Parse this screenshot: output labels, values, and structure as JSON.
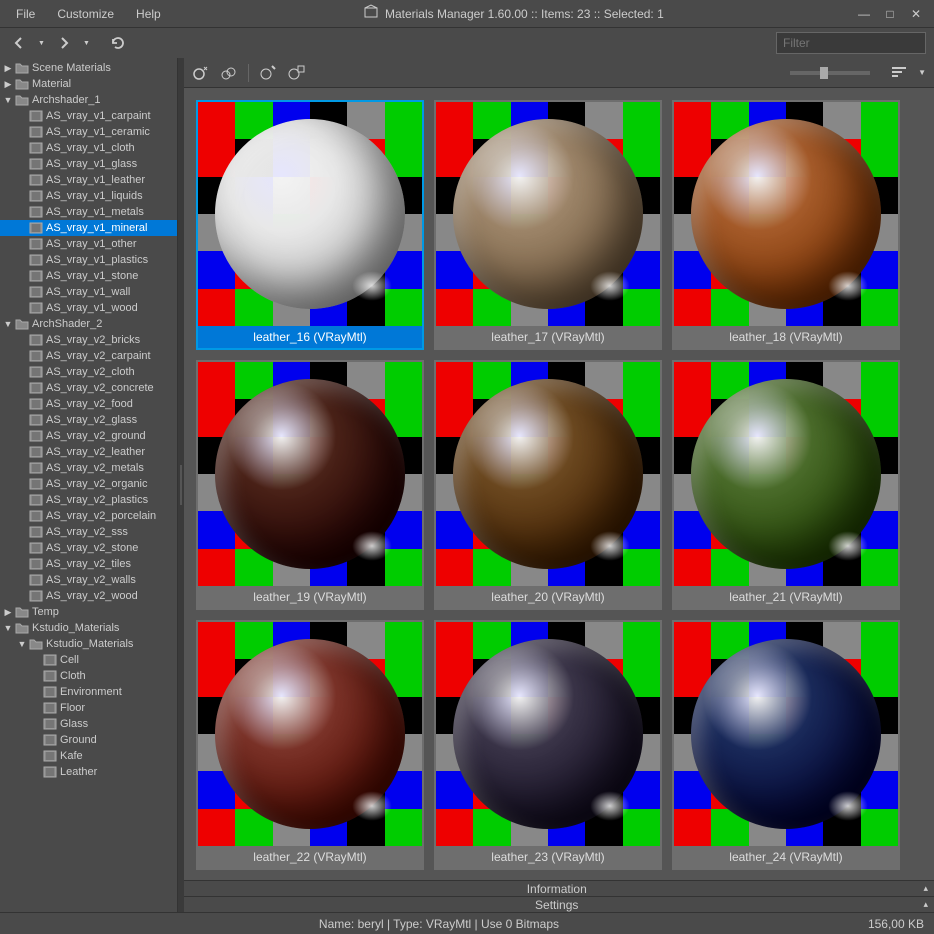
{
  "title": "Materials Manager 1.60.00  :: Items: 23  :: Selected: 1",
  "menu": {
    "file": "File",
    "customize": "Customize",
    "help": "Help"
  },
  "filter_placeholder": "Filter",
  "tree": [
    {
      "indent": 0,
      "toggle": "▶",
      "icon": "folder",
      "label": "Scene Materials"
    },
    {
      "indent": 0,
      "toggle": "▶",
      "icon": "folder",
      "label": "Material"
    },
    {
      "indent": 0,
      "toggle": "▼",
      "icon": "folder",
      "label": "Archshader_1"
    },
    {
      "indent": 1,
      "toggle": "",
      "icon": "mat",
      "label": "AS_vray_v1_carpaint"
    },
    {
      "indent": 1,
      "toggle": "",
      "icon": "mat",
      "label": "AS_vray_v1_ceramic"
    },
    {
      "indent": 1,
      "toggle": "",
      "icon": "mat",
      "label": "AS_vray_v1_cloth"
    },
    {
      "indent": 1,
      "toggle": "",
      "icon": "mat",
      "label": "AS_vray_v1_glass"
    },
    {
      "indent": 1,
      "toggle": "",
      "icon": "mat",
      "label": "AS_vray_v1_leather"
    },
    {
      "indent": 1,
      "toggle": "",
      "icon": "mat",
      "label": "AS_vray_v1_liquids"
    },
    {
      "indent": 1,
      "toggle": "",
      "icon": "mat",
      "label": "AS_vray_v1_metals"
    },
    {
      "indent": 1,
      "toggle": "",
      "icon": "mat",
      "label": "AS_vray_v1_mineral",
      "selected": true
    },
    {
      "indent": 1,
      "toggle": "",
      "icon": "mat",
      "label": "AS_vray_v1_other"
    },
    {
      "indent": 1,
      "toggle": "",
      "icon": "mat",
      "label": "AS_vray_v1_plastics"
    },
    {
      "indent": 1,
      "toggle": "",
      "icon": "mat",
      "label": "AS_vray_v1_stone"
    },
    {
      "indent": 1,
      "toggle": "",
      "icon": "mat",
      "label": "AS_vray_v1_wall"
    },
    {
      "indent": 1,
      "toggle": "",
      "icon": "mat",
      "label": "AS_vray_v1_wood"
    },
    {
      "indent": 0,
      "toggle": "▼",
      "icon": "folder",
      "label": "ArchShader_2"
    },
    {
      "indent": 1,
      "toggle": "",
      "icon": "mat",
      "label": "AS_vray_v2_bricks"
    },
    {
      "indent": 1,
      "toggle": "",
      "icon": "mat",
      "label": "AS_vray_v2_carpaint"
    },
    {
      "indent": 1,
      "toggle": "",
      "icon": "mat",
      "label": "AS_vray_v2_cloth"
    },
    {
      "indent": 1,
      "toggle": "",
      "icon": "mat",
      "label": "AS_vray_v2_concrete"
    },
    {
      "indent": 1,
      "toggle": "",
      "icon": "mat",
      "label": "AS_vray_v2_food"
    },
    {
      "indent": 1,
      "toggle": "",
      "icon": "mat",
      "label": "AS_vray_v2_glass"
    },
    {
      "indent": 1,
      "toggle": "",
      "icon": "mat",
      "label": "AS_vray_v2_ground"
    },
    {
      "indent": 1,
      "toggle": "",
      "icon": "mat",
      "label": "AS_vray_v2_leather"
    },
    {
      "indent": 1,
      "toggle": "",
      "icon": "mat",
      "label": "AS_vray_v2_metals"
    },
    {
      "indent": 1,
      "toggle": "",
      "icon": "mat",
      "label": "AS_vray_v2_organic"
    },
    {
      "indent": 1,
      "toggle": "",
      "icon": "mat",
      "label": "AS_vray_v2_plastics"
    },
    {
      "indent": 1,
      "toggle": "",
      "icon": "mat",
      "label": "AS_vray_v2_porcelain"
    },
    {
      "indent": 1,
      "toggle": "",
      "icon": "mat",
      "label": "AS_vray_v2_sss"
    },
    {
      "indent": 1,
      "toggle": "",
      "icon": "mat",
      "label": "AS_vray_v2_stone"
    },
    {
      "indent": 1,
      "toggle": "",
      "icon": "mat",
      "label": "AS_vray_v2_tiles"
    },
    {
      "indent": 1,
      "toggle": "",
      "icon": "mat",
      "label": "AS_vray_v2_walls"
    },
    {
      "indent": 1,
      "toggle": "",
      "icon": "mat",
      "label": "AS_vray_v2_wood"
    },
    {
      "indent": 0,
      "toggle": "▶",
      "icon": "folder",
      "label": "Temp"
    },
    {
      "indent": 0,
      "toggle": "▼",
      "icon": "folder",
      "label": "Kstudio_Materials"
    },
    {
      "indent": 1,
      "toggle": "▼",
      "icon": "folder",
      "label": "Kstudio_Materials"
    },
    {
      "indent": 2,
      "toggle": "",
      "icon": "mat",
      "label": "Cell"
    },
    {
      "indent": 2,
      "toggle": "",
      "icon": "mat",
      "label": "Cloth"
    },
    {
      "indent": 2,
      "toggle": "",
      "icon": "mat",
      "label": "Environment"
    },
    {
      "indent": 2,
      "toggle": "",
      "icon": "mat",
      "label": "Floor"
    },
    {
      "indent": 2,
      "toggle": "",
      "icon": "mat",
      "label": "Glass"
    },
    {
      "indent": 2,
      "toggle": "",
      "icon": "mat",
      "label": "Ground"
    },
    {
      "indent": 2,
      "toggle": "",
      "icon": "mat",
      "label": "Kafe"
    },
    {
      "indent": 2,
      "toggle": "",
      "icon": "mat",
      "label": "Leather"
    }
  ],
  "thumbs": [
    {
      "label": "leather_16 (VRayMtl)",
      "color": "#e8e8e8",
      "selected": true
    },
    {
      "label": "leather_17 (VRayMtl)",
      "color": "#9c8468"
    },
    {
      "label": "leather_18 (VRayMtl)",
      "color": "#a55b2a"
    },
    {
      "label": "leather_19 (VRayMtl)",
      "color": "#4a2218"
    },
    {
      "label": "leather_20 (VRayMtl)",
      "color": "#6b4820"
    },
    {
      "label": "leather_21 (VRayMtl)",
      "color": "#4a6b2a"
    },
    {
      "label": "leather_22 (VRayMtl)",
      "color": "#7a3228"
    },
    {
      "label": "leather_23 (VRayMtl)",
      "color": "#3a3448"
    },
    {
      "label": "leather_24 (VRayMtl)",
      "color": "#1a2a5a"
    }
  ],
  "info_strip": {
    "information": "Information",
    "settings": "Settings"
  },
  "status": {
    "left": "Name: beryl | Type: VRayMtl | Use 0 Bitmaps",
    "right": "156,00 KB"
  },
  "checker_colors": [
    "#e00",
    "#0c0",
    "#00e",
    "#000",
    "#888",
    "#0c0",
    "#e00",
    "#000",
    "#00e",
    "#888",
    "#e00",
    "#0c0",
    "#000",
    "#00e",
    "#888",
    "#e00",
    "#0c0",
    "#000",
    "#888",
    "#00e",
    "#0c0",
    "#e00",
    "#000",
    "#888",
    "#00e",
    "#e00",
    "#0c0",
    "#888",
    "#000",
    "#00e",
    "#e00",
    "#0c0",
    "#888",
    "#00e",
    "#000",
    "#0c0"
  ]
}
